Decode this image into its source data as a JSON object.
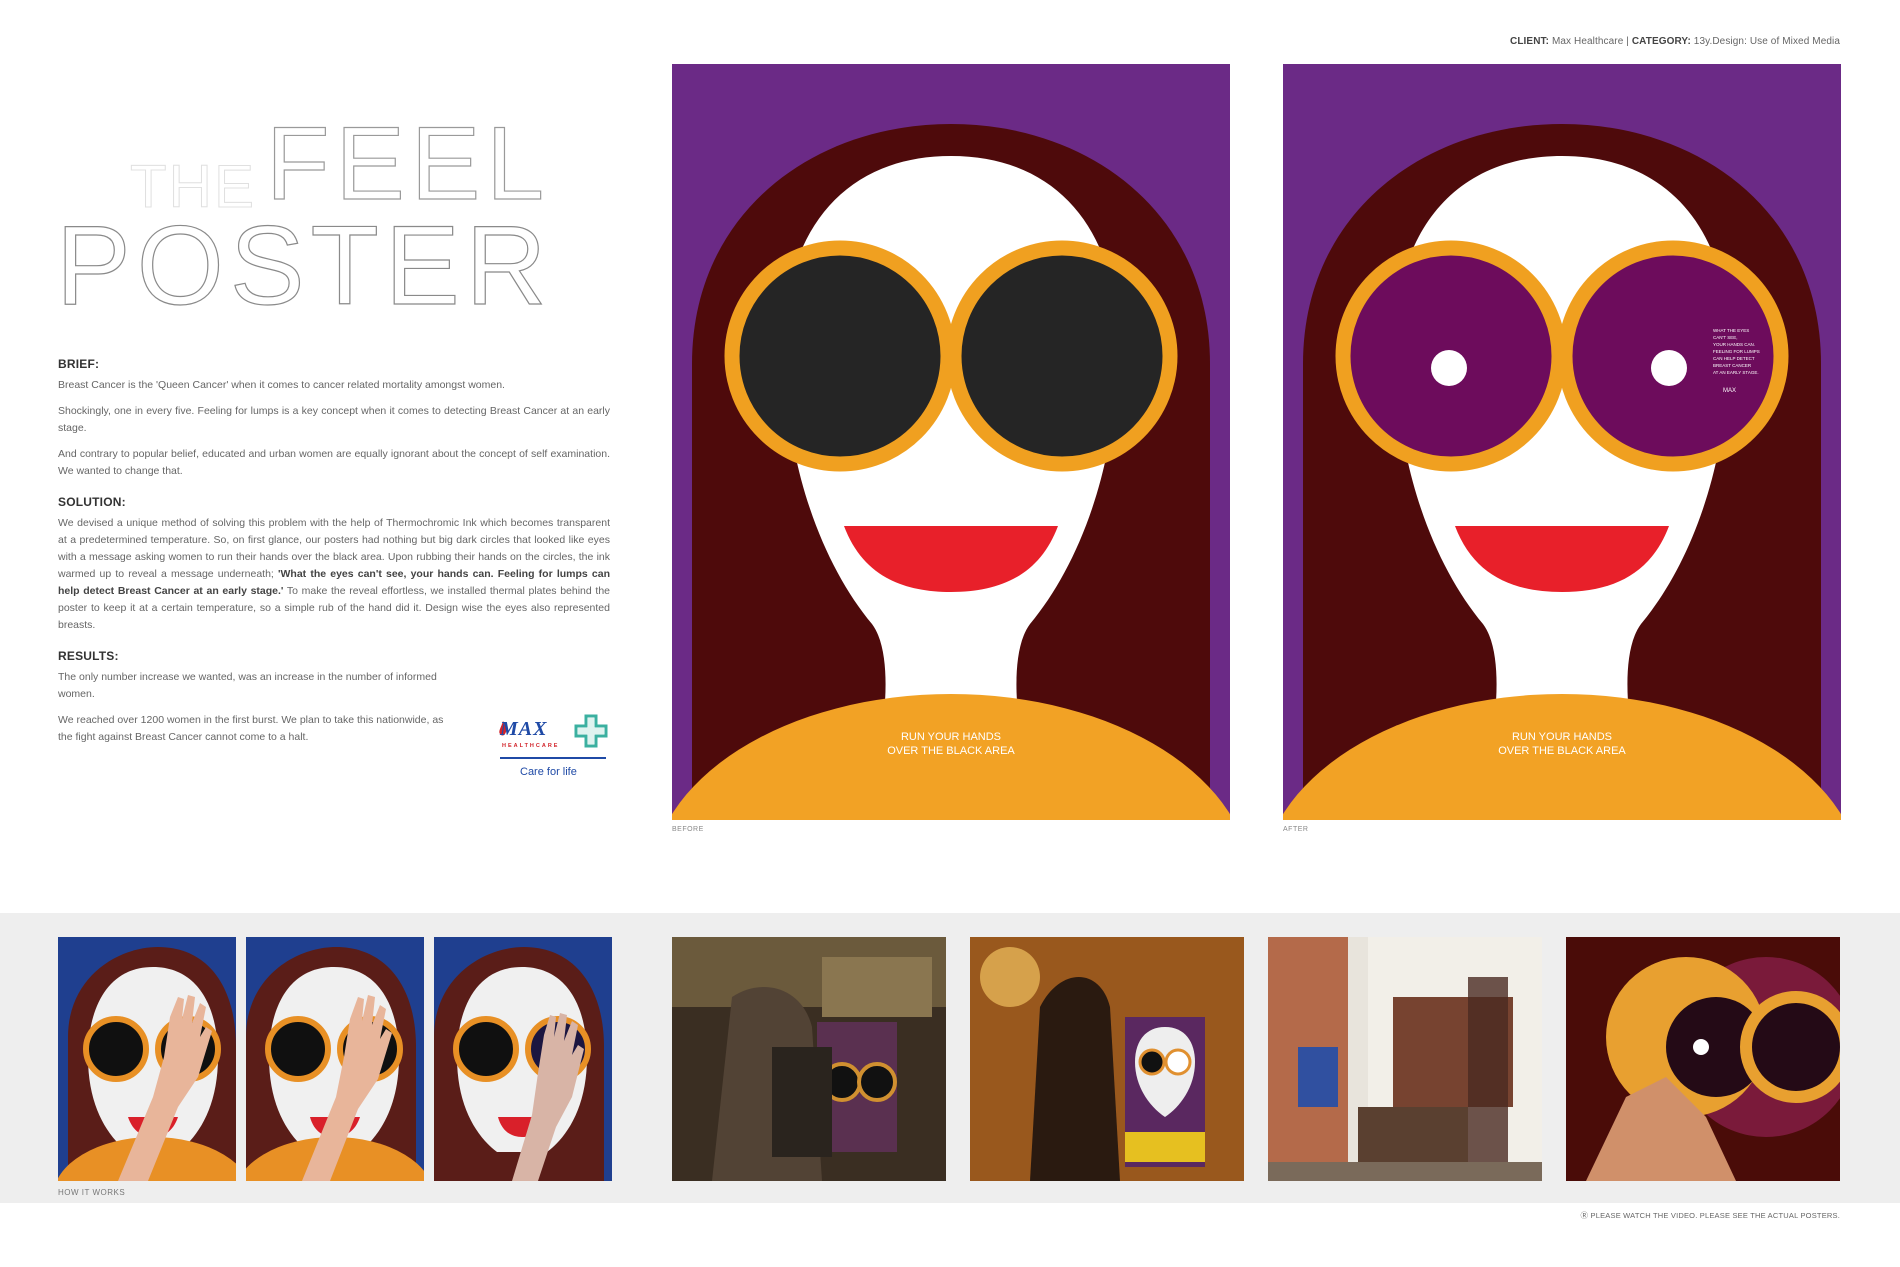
{
  "header": {
    "client_label": "CLIENT:",
    "client_value": "Max Healthcare",
    "category_label": "CATEGORY:",
    "category_value": "13y.Design: Use of Mixed Media"
  },
  "title": {
    "line1_small": "THE",
    "line1_large": "FEEL",
    "line2": "POSTER"
  },
  "brief": {
    "heading": "BRIEF:",
    "paragraphs": [
      "Breast Cancer is the 'Queen Cancer' when it comes to cancer related mortality amongst women.",
      "Shockingly, one in every five. Feeling for lumps is a key concept when it comes to detecting Breast Cancer at an early stage.",
      "And contrary to popular belief, educated and urban women are equally ignorant about the concept of self examination. We wanted to change that."
    ]
  },
  "solution": {
    "heading": "SOLUTION:",
    "text_before": "We devised a unique method of solving this problem with the help of Thermochromic Ink which becomes transparent at a predetermined temperature. So, on first glance, our posters had nothing but big dark circles that looked like eyes with a message asking women to run their hands over the black area. Upon rubbing their hands on the circles, the ink warmed up to reveal a message underneath; ",
    "text_bold": "'What the eyes can't see, your hands can. Feeling for lumps can help detect Breast Cancer at an early stage.'",
    "text_after": " To make the reveal effortless, we installed thermal plates behind the poster to keep it at a certain temperature, so a simple rub of the hand did it. Design wise the eyes also represented breasts."
  },
  "results": {
    "heading": "RESULTS:",
    "paragraphs": [
      "The only number increase we wanted, was an increase in the number of informed women.",
      "We reached over 1200 women in the first burst. We plan to take this nationwide, as the fight against Breast Cancer cannot come to a halt."
    ]
  },
  "logo": {
    "wordmark": "MAX",
    "sub": "HEALTHCARE",
    "tagline": "Care for life"
  },
  "posters": {
    "before": {
      "caption": "BEFORE",
      "cta_line1": "RUN YOUR HANDS",
      "cta_line2": "OVER THE BLACK AREA"
    },
    "after": {
      "caption": "AFTER",
      "cta_line1": "RUN YOUR HANDS",
      "cta_line2": "OVER THE BLACK AREA",
      "reveal_lines": [
        "WHAT THE EYES",
        "CAN'T SEE,",
        "YOUR HANDS CAN.",
        "FEELING FOR LUMPS",
        "CAN HELP DETECT",
        "BREAST CANCER",
        "AT AN EARLY STAGE."
      ],
      "reveal_logo": "MAX"
    }
  },
  "how_it_works_caption": "HOW IT WORKS",
  "footer_note": "PLEASE WATCH THE VIDEO. PLEASE SEE THE ACTUAL POSTERS.",
  "colors": {
    "purple_bg": "#6b2a86",
    "hair": "#4e0a0b",
    "ring": "#f0a020",
    "lens_dark": "#252525",
    "lens_revealed": "#6d0c5c",
    "lips": "#e8202a",
    "shoulders": "#f2a225",
    "brand_blue": "#1f4aa6",
    "brand_red": "#d2232a",
    "brand_green": "#3bb0a0"
  }
}
